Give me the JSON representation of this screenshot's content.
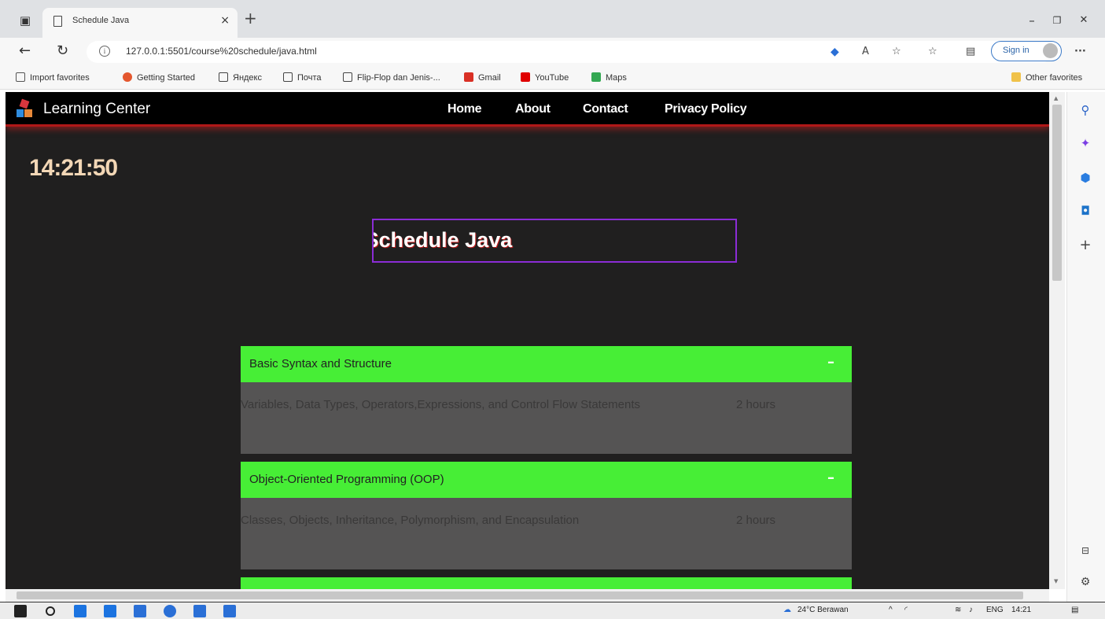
{
  "browser": {
    "tab_title": "Schedule Java",
    "tab_close": "×",
    "new_tab": "+",
    "url": "127.0.0.1:5501/course%20schedule/java.html",
    "sign_in": "Sign in",
    "window_controls": {
      "minimize": "–",
      "restore": "❐",
      "close": "✕"
    },
    "nav": {
      "back": "←",
      "refresh": "↻",
      "more": "···"
    },
    "bookmarks": [
      {
        "label": "Import favorites",
        "color": "#555555"
      },
      {
        "label": "Getting Started",
        "color": "#e4572e"
      },
      {
        "label": "Яндекс",
        "color": "#ffffff"
      },
      {
        "label": "Почта",
        "color": "#ffffff"
      },
      {
        "label": "Flip-Flop dan Jenis-...",
        "color": "#ffffff"
      },
      {
        "label": "Gmail",
        "color": "#d93025"
      },
      {
        "label": "YouTube",
        "color": "#e00000"
      },
      {
        "label": "Maps",
        "color": "#34a853"
      }
    ],
    "other_favorites": "Other favorites"
  },
  "site": {
    "brand": "Learning Center",
    "menu": [
      "Home",
      "About",
      "Contact",
      "Privacy Policy"
    ],
    "clock": "14:21:50",
    "page_title": "Course Schedule Java",
    "accordion": [
      {
        "title": "Basic Syntax and Structure",
        "toggle": "–",
        "description": "Variables, Data Types, Operators,Expressions, and Control Flow Statements",
        "duration": "2 hours"
      },
      {
        "title": "Object-Oriented Programming (OOP)",
        "toggle": "–",
        "description": "Classes, Objects, Inheritance, Polymorphism, and Encapsulation",
        "duration": "2 hours"
      }
    ]
  },
  "taskbar": {
    "weather": "24°C Berawan",
    "language": "ENG",
    "time": "14:21"
  },
  "colors": {
    "accordion_header": "#47ee36",
    "accordion_body": "#555454",
    "page_bg": "#201f1f",
    "nav_underline": "#b01818",
    "title_border": "#8b2cd6",
    "clock": "#f3d7b6"
  }
}
